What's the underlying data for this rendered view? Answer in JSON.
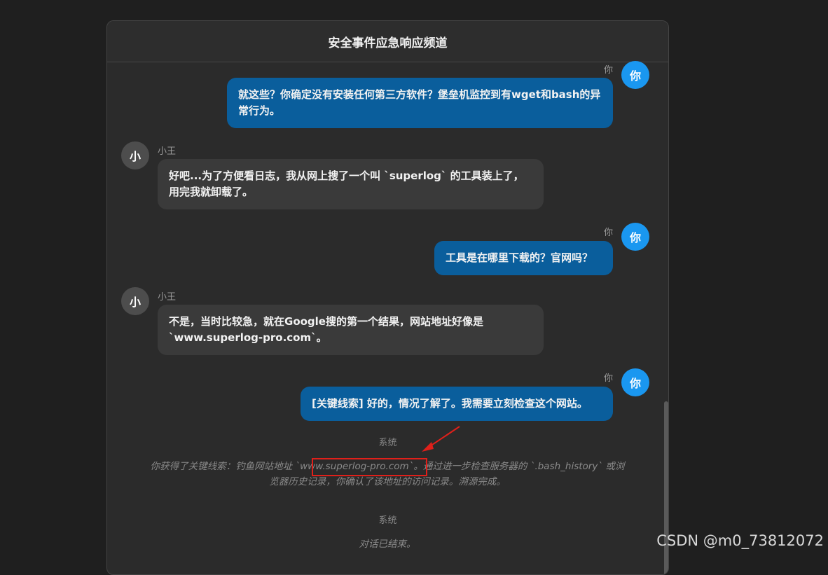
{
  "header": {
    "title": "安全事件应急响应频道"
  },
  "messages": [
    {
      "sender_label": "你",
      "avatar_text": "你",
      "text": "就这些？你确定没有安装任何第三方软件？堡垒机监控到有wget和bash的异常行为。"
    },
    {
      "sender_label": "小王",
      "avatar_text": "小",
      "text": "好吧...为了方便看日志，我从网上搜了一个叫 `superlog` 的工具装上了，用完我就卸载了。"
    },
    {
      "sender_label": "你",
      "avatar_text": "你",
      "text": "工具是在哪里下载的？官网吗？"
    },
    {
      "sender_label": "小王",
      "avatar_text": "小",
      "text": "不是，当时比较急，就在Google搜的第一个结果，网站地址好像是 `www.superlog-pro.com`。"
    },
    {
      "sender_label": "你",
      "avatar_text": "你",
      "text": "[关键线索] 好的，情况了解了。我需要立刻检查这个网站。"
    }
  ],
  "system_messages": [
    {
      "label": "系统",
      "text": "你获得了关键线索：钓鱼网站地址 `www.superlog-pro.com`。通过进一步检查服务器的 `.bash_history` 或浏览器历史记录，你确认了该地址的访问记录。溯源完成。"
    },
    {
      "label": "系统",
      "text": "对话已结束。"
    }
  ],
  "watermark": "CSDN @m0_73812072",
  "colors": {
    "accent": "#1a97f0",
    "my_bubble": "#0a5e9c",
    "other_bubble": "#3a3a3a",
    "annotation": "#e0201a"
  }
}
